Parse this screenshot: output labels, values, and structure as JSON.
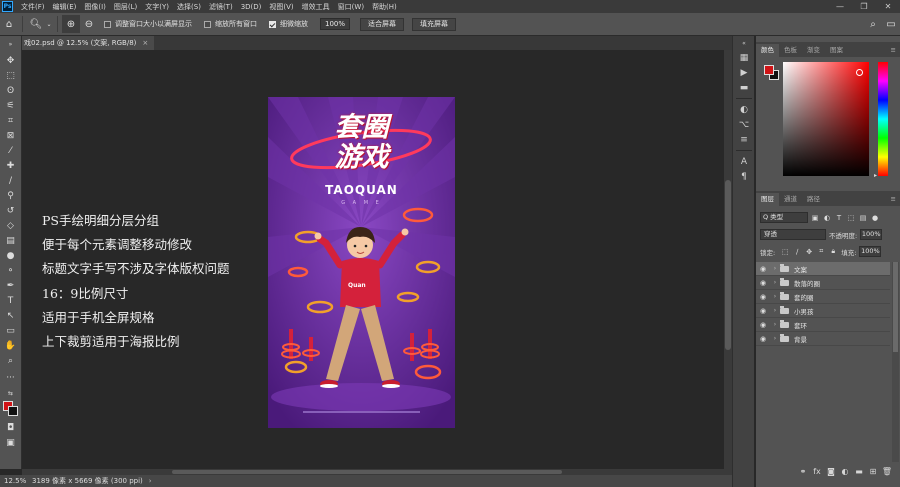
{
  "menubar": {
    "logo": "Ps",
    "items": [
      "文件(F)",
      "编辑(E)",
      "图像(I)",
      "图层(L)",
      "文字(Y)",
      "选择(S)",
      "滤镜(T)",
      "3D(D)",
      "视图(V)",
      "增效工具",
      "窗口(W)",
      "帮助(H)"
    ],
    "window_controls": [
      "—",
      "❐",
      "✕"
    ]
  },
  "optionsbar": {
    "resize_windows_label": "调整窗口大小以满屏显示",
    "zoom_all_label": "缩放所有窗口",
    "scrubby_zoom_label": "细微缩放",
    "zoom_value": "100%",
    "fit_screen_label": "适合屏幕",
    "fill_screen_label": "填充屏幕"
  },
  "document": {
    "tab_title": "戏02.psd @ 12.5% (文案, RGB/8)",
    "tab_close": "×"
  },
  "description": [
    "PS手绘明细分层分组",
    "便于每个元素调整移动修改",
    "标题文字手写不涉及字体版权问题",
    "16：9比例尺寸",
    "适用于手机全屏规格",
    "上下裁剪适用于海报比例"
  ],
  "poster": {
    "title_line1": "套圈",
    "title_line2": "游戏",
    "subtitle_en": "TAOQUAN",
    "subtitle_small": "G A M E",
    "shirt_text": "Quan",
    "colors": {
      "bg": "#5a2390",
      "ray": "#6f33a8",
      "ring": "#f2a02a",
      "red": "#d4213b",
      "pants": "#d2a679"
    }
  },
  "statusbar": {
    "zoom": "12.5%",
    "info": "3189 像素 x 5669 像素 (300 ppi)",
    "arrow": "›"
  },
  "colorpanel": {
    "tabs": [
      "颜色",
      "色板",
      "渐变",
      "图案"
    ],
    "active_tab": "颜色",
    "foreground": "#d01416",
    "background": "#111111"
  },
  "layerspanel": {
    "tabs": [
      "图层",
      "通道",
      "路径"
    ],
    "active_tab": "图层",
    "filter_label": "Q 类型",
    "blend_mode": "穿透",
    "opacity_label": "不透明度:",
    "opacity_value": "100%",
    "lock_label": "锁定:",
    "fill_label": "填充:",
    "fill_value": "100%",
    "layers": [
      {
        "name": "文案",
        "selected": true
      },
      {
        "name": "散落的圈",
        "selected": false
      },
      {
        "name": "套的圈",
        "selected": false
      },
      {
        "name": "小男孩",
        "selected": false
      },
      {
        "name": "套环",
        "selected": false
      },
      {
        "name": "背景",
        "selected": false
      }
    ]
  }
}
